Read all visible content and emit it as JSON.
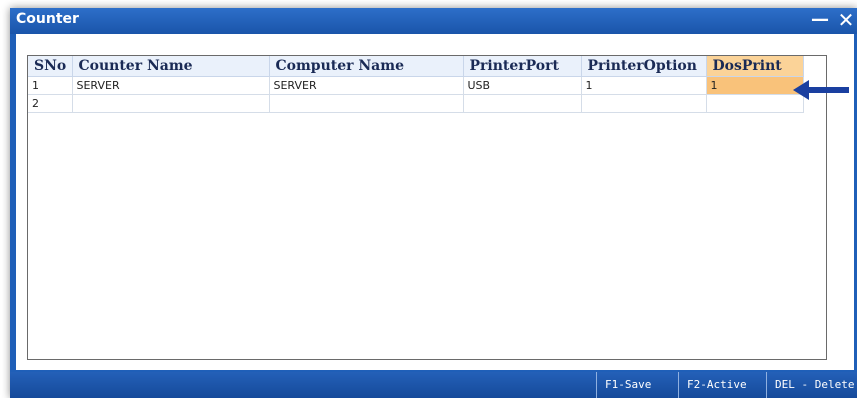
{
  "window": {
    "title": "Counter"
  },
  "grid": {
    "columns": [
      "SNo",
      "Counter Name",
      "Computer Name",
      "PrinterPort",
      "PrinterOption",
      "DosPrint"
    ],
    "rows": [
      [
        "1",
        "SERVER",
        "SERVER",
        "USB",
        "1",
        "1"
      ],
      [
        "2",
        "",
        "",
        "",
        "",
        ""
      ]
    ],
    "active_column": "DosPrint"
  },
  "status_keys": [
    {
      "label": "F1-Save"
    },
    {
      "label": "F2-Active"
    },
    {
      "label": "DEL - Delete"
    }
  ],
  "colors": {
    "title_bar": "#1f5fb8",
    "active_header": "#fbd398",
    "active_cell": "#f9c27a",
    "arrow": "#1a3fa0"
  },
  "icons": {
    "minimize": "minimize-icon",
    "close": "close-icon",
    "annotation": "left-arrow-icon"
  }
}
